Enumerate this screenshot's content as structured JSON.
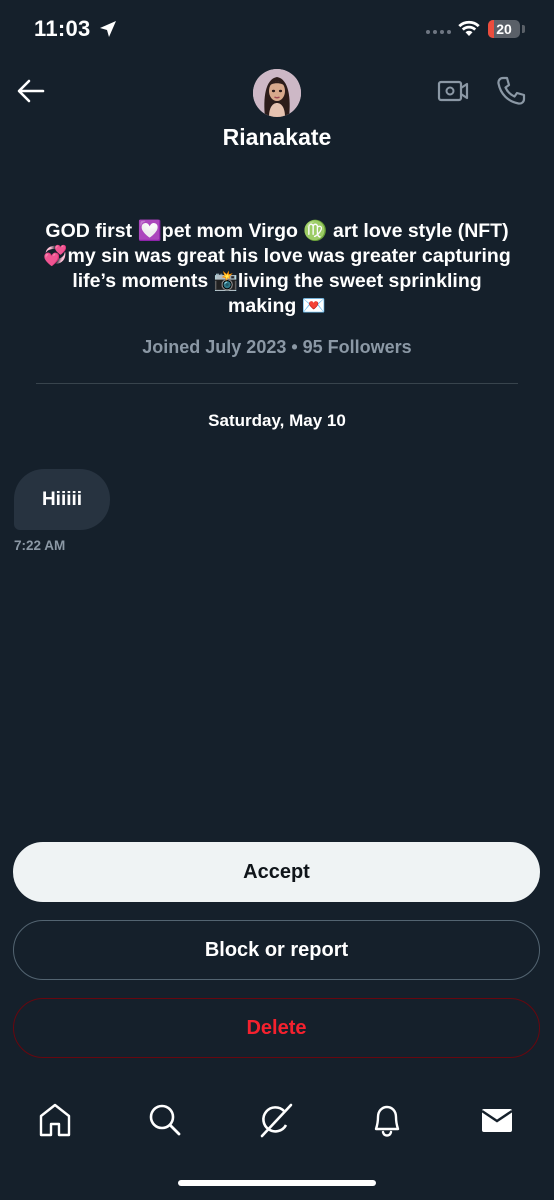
{
  "status_bar": {
    "time": "11:03",
    "battery_level": "20",
    "battery_fraction": 0.2,
    "battery_color": "#eb4d3d",
    "icons": [
      "location-arrow-icon",
      "signal-dots-icon",
      "wifi-icon",
      "battery-icon"
    ]
  },
  "header": {
    "display_name": "Rianakate",
    "icons": [
      "back-arrow-icon",
      "video-camera-icon",
      "phone-icon",
      "avatar"
    ]
  },
  "profile": {
    "bio": "GOD first 💟pet mom Virgo ♍️ art love style (NFT)💞my sin was great his love was greater capturing life’s moments 📸living the sweet sprinkling making 💌",
    "meta": "Joined July 2023 • 95 Followers"
  },
  "conversation": {
    "date_separator": "Saturday, May 10",
    "messages": [
      {
        "text": "Hiiiii",
        "time": "7:22 AM"
      }
    ]
  },
  "actions": {
    "accept_label": "Accept",
    "block_label": "Block or report",
    "delete_label": "Delete"
  },
  "tab_bar": {
    "items": [
      "home-icon",
      "search-icon",
      "grok-icon",
      "notifications-icon",
      "messages-icon"
    ]
  },
  "colors": {
    "background": "#15202b",
    "bubble": "#273340",
    "secondary_text": "#8b98a5",
    "delete_red": "#f4212e"
  }
}
